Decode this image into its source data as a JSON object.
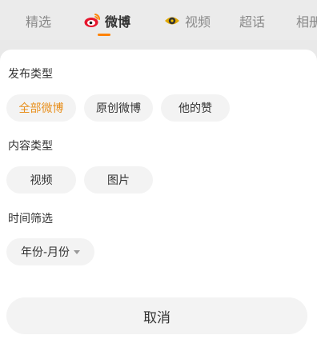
{
  "tabs": [
    {
      "label": "精选",
      "active": false
    },
    {
      "label": "微博",
      "active": true,
      "icon": "weibo-icon"
    },
    {
      "label": "视频",
      "active": false,
      "icon": "video-eye-icon"
    },
    {
      "label": "超话",
      "active": false
    },
    {
      "label": "相册",
      "active": false
    }
  ],
  "filter": {
    "publish_type": {
      "title": "发布类型",
      "options": [
        "全部微博",
        "原创微博",
        "他的赞"
      ],
      "selected": "全部微博"
    },
    "content_type": {
      "title": "内容类型",
      "options": [
        "视频",
        "图片"
      ]
    },
    "time_filter": {
      "title": "时间筛选",
      "dropdown_label": "年份-月份"
    },
    "cancel_label": "取消"
  },
  "colors": {
    "accent": "#e8901e",
    "tab_underline": "#ff8200",
    "chip_bg": "#f3f3f3"
  }
}
